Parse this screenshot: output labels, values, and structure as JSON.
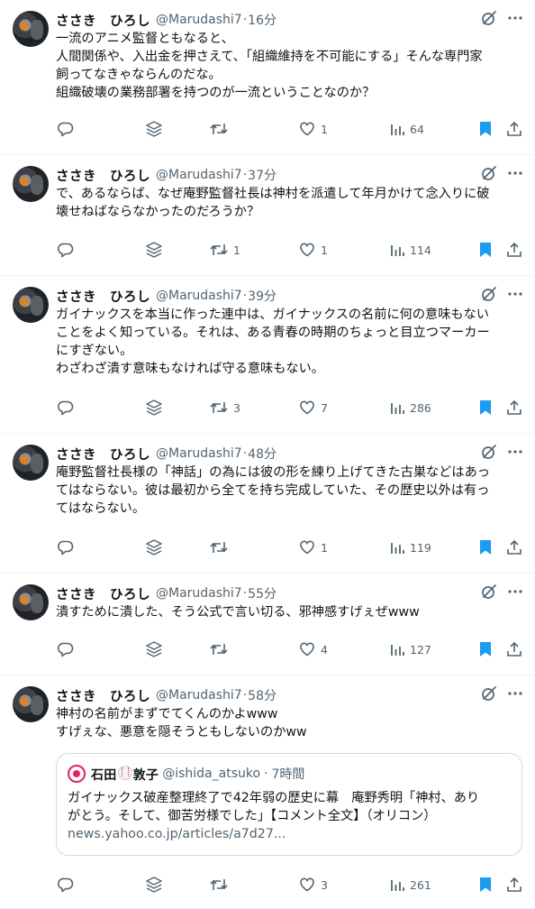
{
  "colors": {
    "text": "#0f1419",
    "secondary": "#536471",
    "bookmark": "#1d9bf0",
    "divider": "#eff3f4"
  },
  "icons": {
    "grok": "grok-icon",
    "more": "more-icon",
    "reply": "reply-icon",
    "stack": "stack-icon",
    "retweet": "retweet-icon",
    "like": "heart-icon",
    "views": "views-icon",
    "bookmark": "bookmark-icon",
    "share": "share-icon"
  },
  "tweets": [
    {
      "name": "ささき　ひろし",
      "handle": "@Marudashi7",
      "dot": "·",
      "time": "16分",
      "lines": [
        "一流のアニメ監督ともなると、",
        "人間関係や、入出金を押さえて、「組織維持を不可能にする」そんな専門家",
        "飼ってなきゃならんのだな。",
        "組織破壊の業務部署を持つのが一流ということなのか？"
      ],
      "retweets": "",
      "likes": "1",
      "views": "64"
    },
    {
      "name": "ささき　ひろし",
      "handle": "@Marudashi7",
      "dot": "·",
      "time": "37分",
      "lines": [
        "で、あるならば、なぜ庵野監督社長は神村を派遣して年月かけて念入りに破",
        "壊せねばならなかったのだろうか？"
      ],
      "retweets": "1",
      "likes": "1",
      "views": "114"
    },
    {
      "name": "ささき　ひろし",
      "handle": "@Marudashi7",
      "dot": "·",
      "time": "39分",
      "lines": [
        "ガイナックスを本当に作った連中は、ガイナックスの名前に何の意味もない",
        "ことをよく知っている。それは、ある青春の時期のちょっと目立つマーカー",
        "にすぎない。",
        "わざわざ潰す意味もなければ守る意味もない。"
      ],
      "retweets": "3",
      "likes": "7",
      "views": "286"
    },
    {
      "name": "ささき　ひろし",
      "handle": "@Marudashi7",
      "dot": "·",
      "time": "48分",
      "lines": [
        "庵野監督社長様の「神話」の為には彼の形を練り上げてきた古巣などはあっ",
        "てはならない。彼は最初から全てを持ち完成していた、その歴史以外は有っ",
        "てはならない。"
      ],
      "retweets": "",
      "likes": "1",
      "views": "119"
    },
    {
      "name": "ささき　ひろし",
      "handle": "@Marudashi7",
      "dot": "·",
      "time": "55分",
      "lines": [
        "潰すために潰した、そう公式で言い切る、邪神感すげぇぜwww"
      ],
      "retweets": "",
      "likes": "4",
      "views": "127"
    },
    {
      "name": "ささき　ひろし",
      "handle": "@Marudashi7",
      "dot": "·",
      "time": "58分",
      "lines": [
        "神村の名前がまずでてくんのかよwww",
        "すげぇな、悪意を隠そうともしないのかww"
      ],
      "retweets": "",
      "likes": "3",
      "views": "261",
      "quote": {
        "name_part1": "石田",
        "name_part2": "敦子",
        "handle": "@ishida_atsuko",
        "dot": "·",
        "time": "7時間",
        "lines": [
          "ガイナックス破産整理終了で42年弱の歴史に幕　庵野秀明「神村、あり",
          "がとう。そして、御苦労様でした」【コメント全文】（オリコン）"
        ],
        "link": "news.yahoo.co.jp/articles/a7d27..."
      }
    }
  ]
}
